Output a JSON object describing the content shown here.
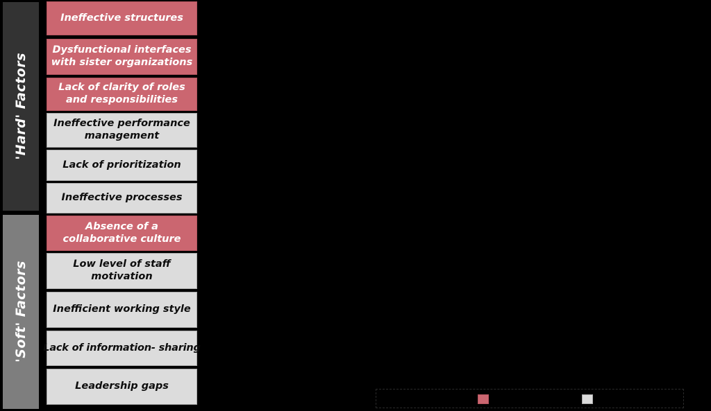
{
  "chart_data": {
    "type": "table",
    "title": "",
    "categories": [
      "'Hard' Factors",
      "'Soft' Factors"
    ],
    "series": [
      {
        "name": "'Hard' Factors",
        "items": [
          {
            "label": "Ineffective structures",
            "highlighted": true
          },
          {
            "label": "Dysfunctional interfaces with sister organizations",
            "highlighted": true
          },
          {
            "label": "Lack of clarity of roles and responsibilities",
            "highlighted": true
          },
          {
            "label": "Ineffective performance management",
            "highlighted": false
          },
          {
            "label": "Lack of prioritization",
            "highlighted": false
          },
          {
            "label": "Ineffective processes",
            "highlighted": false
          }
        ]
      },
      {
        "name": "'Soft' Factors",
        "items": [
          {
            "label": "Absence of a collaborative culture",
            "highlighted": true
          },
          {
            "label": "Low level of staff motivation",
            "highlighted": false
          },
          {
            "label": "Inefficient working style",
            "highlighted": false
          },
          {
            "label": "Lack of information- sharing",
            "highlighted": false
          },
          {
            "label": "Leadership gaps",
            "highlighted": false
          }
        ]
      }
    ],
    "legend": {
      "position": "bottom-right",
      "entries": [
        {
          "swatch_color": "#cb6670",
          "label": ""
        },
        {
          "swatch_color": "#dcdcdc",
          "label": ""
        }
      ]
    },
    "colors": {
      "highlight": "#cb6670",
      "normal": "#dcdcdc",
      "hard_band": "#333333",
      "soft_band": "#7e7e7e",
      "background": "#000000"
    }
  },
  "sidebar": {
    "hard": {
      "label": "'Hard' Factors"
    },
    "soft": {
      "label": "'Soft' Factors"
    }
  },
  "factors": {
    "hard": [
      {
        "label": "Ineffective structures"
      },
      {
        "label": "Dysfunctional interfaces with sister organizations"
      },
      {
        "label": "Lack of clarity of roles and responsibilities"
      },
      {
        "label": "Ineffective performance management"
      },
      {
        "label": "Lack of prioritization"
      },
      {
        "label": "Ineffective processes"
      }
    ],
    "soft": [
      {
        "label": "Absence of a collaborative culture"
      },
      {
        "label": "Low level of staff motivation"
      },
      {
        "label": "Inefficient working style"
      },
      {
        "label": "Lack of information- sharing"
      },
      {
        "label": "Leadership gaps"
      }
    ]
  },
  "legend": {
    "entries": [
      {
        "label": ""
      },
      {
        "label": ""
      }
    ]
  }
}
